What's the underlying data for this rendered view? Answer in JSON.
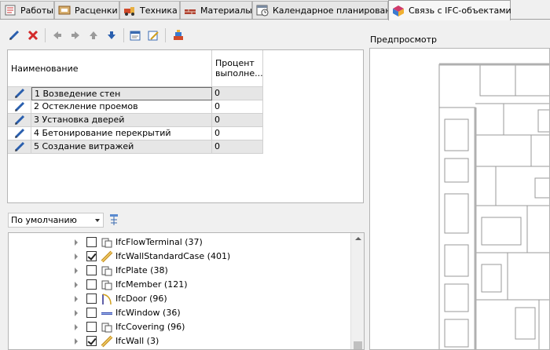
{
  "tabs": [
    {
      "label": "Работы",
      "icon": "works-icon"
    },
    {
      "label": "Расценки",
      "icon": "rates-icon"
    },
    {
      "label": "Техника",
      "icon": "machinery-icon"
    },
    {
      "label": "Материалы",
      "icon": "materials-icon"
    },
    {
      "label": "Календарное планирование",
      "icon": "calendar-icon"
    },
    {
      "label": "Связь с IFC-объектами",
      "icon": "ifc-link-icon"
    }
  ],
  "toolbar": {
    "icons": [
      "edit-icon",
      "delete-icon",
      "arrow-left-icon",
      "arrow-right-icon",
      "arrow-up-icon",
      "arrow-down-icon",
      "properties-icon",
      "edit-properties-icon",
      "link-objects-icon"
    ]
  },
  "grid": {
    "col_name": "Наименование",
    "col_percent": "Процент выполне...",
    "rows": [
      {
        "name": "1 Возведение стен",
        "percent": "0"
      },
      {
        "name": "2 Остекление проемов",
        "percent": "0"
      },
      {
        "name": "3 Установка дверей",
        "percent": "0"
      },
      {
        "name": "4 Бетонирование перекрытий",
        "percent": "0"
      },
      {
        "name": "5 Создание витражей",
        "percent": "0"
      }
    ]
  },
  "filter": {
    "value": "По умолчанию"
  },
  "tree": {
    "items": [
      {
        "label": "IfcFlowTerminal (37)",
        "checked": false,
        "icon": "flow-terminal-icon"
      },
      {
        "label": "IfcWallStandardCase (401)",
        "checked": true,
        "icon": "wall-standard-case-icon"
      },
      {
        "label": "IfcPlate (38)",
        "checked": false,
        "icon": "plate-icon"
      },
      {
        "label": "IfcMember (121)",
        "checked": false,
        "icon": "member-icon"
      },
      {
        "label": "IfcDoor (96)",
        "checked": false,
        "icon": "door-icon"
      },
      {
        "label": "IfcWindow (36)",
        "checked": false,
        "icon": "window-icon"
      },
      {
        "label": "IfcCovering (96)",
        "checked": false,
        "icon": "covering-icon"
      },
      {
        "label": "IfcWall (3)",
        "checked": true,
        "icon": "wall-icon"
      }
    ]
  },
  "preview": {
    "title": "Предпросмотр"
  }
}
